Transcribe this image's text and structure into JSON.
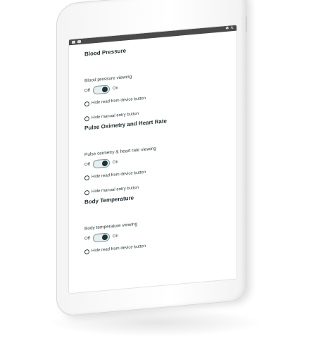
{
  "statusbar": {
    "left_icons": [
      "app-icon",
      "notification-icon"
    ],
    "right_icons": [
      "bluetooth-icon",
      "mute-icon"
    ]
  },
  "sections": [
    {
      "title": "Blood Pressure",
      "viewing_label": "Blood pressure viewing",
      "toggle": {
        "off_label": "Off",
        "on_label": "On",
        "state": "on"
      },
      "options": [
        {
          "label": "Hide read from device button",
          "selected": false
        },
        {
          "label": "Hide manual entry button",
          "selected": false
        }
      ]
    },
    {
      "title": "Pulse Oximetry and Heart Rate",
      "viewing_label": "Pulse oximetry & heart rate viewing",
      "toggle": {
        "off_label": "Off",
        "on_label": "On",
        "state": "on"
      },
      "options": [
        {
          "label": "Hide read from device button",
          "selected": false
        },
        {
          "label": "Hide manual entry button",
          "selected": false
        }
      ]
    },
    {
      "title": "Body Temperature",
      "viewing_label": "Body temperature viewing",
      "toggle": {
        "off_label": "Off",
        "on_label": "On",
        "state": "on"
      },
      "options": [
        {
          "label": "Hide read from device button",
          "selected": false
        }
      ]
    }
  ],
  "colors": {
    "accent_dark": "#1b3236",
    "statusbar": "#4a4a4a",
    "switch_track": "#e6eeee",
    "switch_border": "#7a9a9c"
  }
}
